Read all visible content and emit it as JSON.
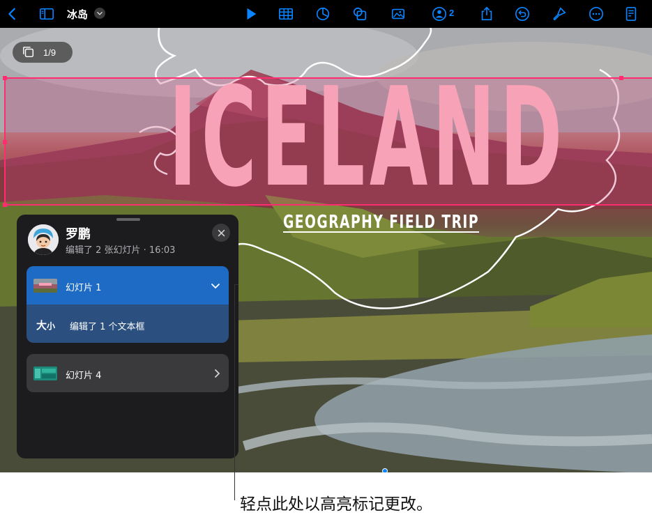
{
  "toolbar": {
    "document_title": "冰岛",
    "collaborator_count": "2",
    "icons": [
      "back-chevron-icon",
      "sidebar-icon",
      "title-menu-chevron-icon",
      "play-icon",
      "table-icon",
      "chart-icon",
      "shapes-icon",
      "media-icon",
      "collaboration-icon",
      "share-icon",
      "undo-icon",
      "format-brush-icon",
      "more-icon",
      "document-setup-icon"
    ],
    "accent_color": "#0a84ff"
  },
  "canvas": {
    "slide_counter": "1/9",
    "title": "ICELAND",
    "subtitle": "GEOGRAPHY FIELD TRIP",
    "highlight_color": "#ff2d6f"
  },
  "activity_panel": {
    "user_name": "罗鹏",
    "user_summary": "编辑了 2 张幻灯片 · 16:03",
    "items": [
      {
        "label": "幻灯片 1",
        "expanded": true,
        "change_icon": "大小",
        "change_text": "编辑了 1 个文本框"
      },
      {
        "label": "幻灯片 4",
        "expanded": false
      }
    ]
  },
  "callout": {
    "text": "轻点此处以高亮标记更改。"
  }
}
